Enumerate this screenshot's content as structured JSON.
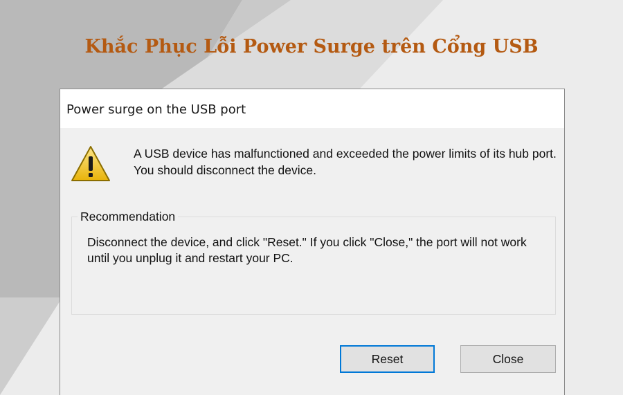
{
  "banner": {
    "title": "Khắc Phục Lỗi Power Surge trên Cổng USB"
  },
  "dialog": {
    "title": "Power surge on the USB port",
    "icon": "warning-icon",
    "message": "A USB device has malfunctioned and exceeded the power limits of its hub port. You should disconnect the device.",
    "recommendation": {
      "label": "Recommendation",
      "text": "Disconnect the device, and click \"Reset.\" If you click \"Close,\" the port will not work until you unplug it and restart your PC."
    },
    "buttons": {
      "reset_label": "Reset",
      "close_label": "Close"
    }
  },
  "colors": {
    "title_accent": "#b45a12",
    "focus_border": "#0078d7",
    "background": "#ececec",
    "warning_yellow": "#f5c518"
  }
}
